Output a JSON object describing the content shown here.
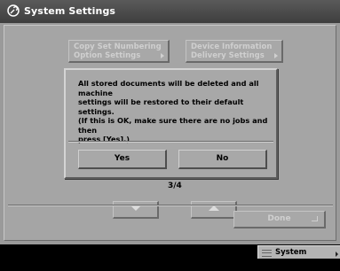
{
  "window": {
    "title": "System Settings",
    "icon": "settings-wrench-icon"
  },
  "settings_buttons": [
    {
      "label_line1": "Copy Set Numbering",
      "label_line2": "Option Settings"
    },
    {
      "label_line1": "Device Information",
      "label_line2": "Delivery Settings"
    }
  ],
  "dialog": {
    "line1": "All stored documents will be deleted and all machine",
    "line2": "settings will be restored to their default settings.",
    "line3": "(If this is OK, make sure there are no jobs and then",
    "line4": "press [Yes].)",
    "yes_label": "Yes",
    "no_label": "No"
  },
  "pager": {
    "page": "3/4",
    "prev_icon": "arrow-down-icon",
    "next_icon": "arrow-up-icon"
  },
  "footer": {
    "done_label": "Done",
    "done_icon": "return-icon"
  },
  "status_bar": {
    "system_monitor_label": "System Monitor",
    "icon": "list-lines-icon"
  }
}
